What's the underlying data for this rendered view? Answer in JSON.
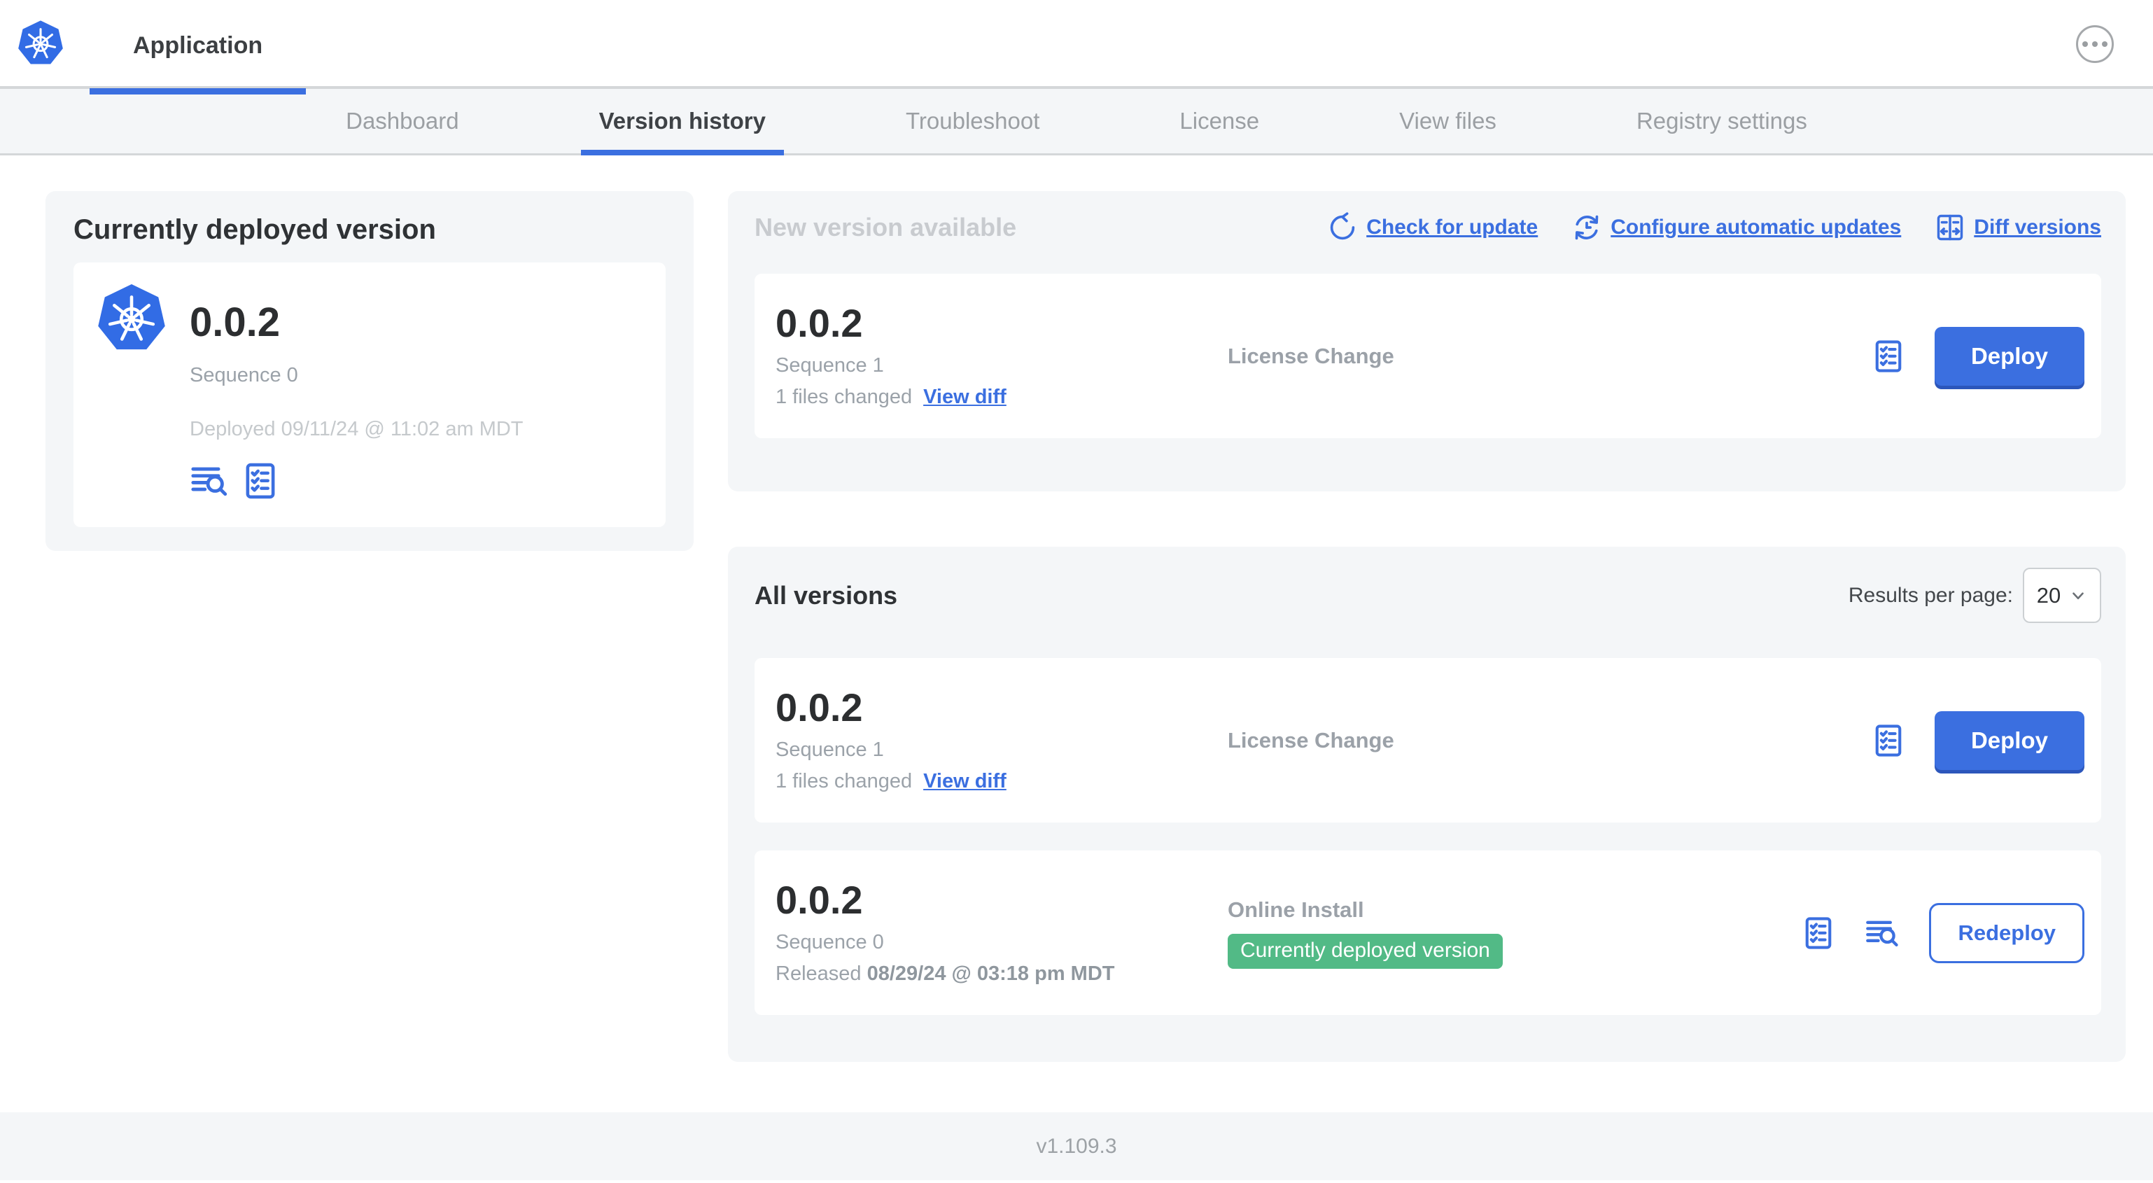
{
  "header": {
    "app_title": "Application"
  },
  "nav": {
    "tabs": [
      {
        "label": "Dashboard"
      },
      {
        "label": "Version history"
      },
      {
        "label": "Troubleshoot"
      },
      {
        "label": "License"
      },
      {
        "label": "View files"
      },
      {
        "label": "Registry settings"
      }
    ]
  },
  "current_version": {
    "title": "Currently deployed version",
    "version": "0.0.2",
    "sequence": "Sequence 0",
    "deployed": "Deployed 09/11/24 @ 11:02 am MDT"
  },
  "new_version": {
    "title": "New version available",
    "actions": [
      {
        "label": "Check for update",
        "icon": "refresh-icon"
      },
      {
        "label": "Configure automatic updates",
        "icon": "schedule-update-icon"
      },
      {
        "label": "Diff versions",
        "icon": "diff-icon"
      }
    ],
    "card": {
      "version": "0.0.2",
      "sequence": "Sequence 1",
      "files_changed": "1 files changed",
      "view_diff_label": "View diff",
      "source": "License Change",
      "deploy_label": "Deploy"
    }
  },
  "all_versions": {
    "title": "All versions",
    "results_per_page_label": "Results per page:",
    "results_per_page_value": "20",
    "rows": [
      {
        "version": "0.0.2",
        "sequence": "Sequence 1",
        "files_changed": "1 files changed",
        "view_diff_label": "View diff",
        "source": "License Change",
        "action_label": "Deploy"
      },
      {
        "version": "0.0.2",
        "sequence": "Sequence 0",
        "released_prefix": "Released ",
        "released_date": "08/29/24 @ 03:18 pm MDT",
        "source": "Online Install",
        "badge": "Currently deployed version",
        "action_label": "Redeploy"
      }
    ]
  },
  "footer": {
    "version": "v1.109.3"
  },
  "colors": {
    "accent_blue": "#3b6fe0",
    "k8s_logo_blue": "#326ce5",
    "badge_green": "#52ba86",
    "panel_gray": "#f4f6f8"
  }
}
